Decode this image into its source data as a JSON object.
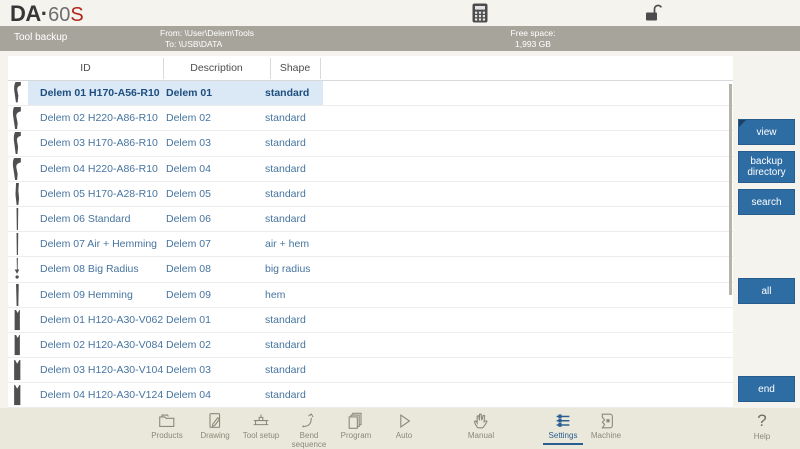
{
  "logo": {
    "brand": "DA",
    "separator": "·",
    "model": "60",
    "series": "S"
  },
  "top_icons": {
    "calculator": "calculator-icon",
    "lock": "unlock-icon"
  },
  "status_bar": {
    "title": "Tool backup",
    "from": "From: \\User\\Delem\\Tools",
    "to": "To: \\USB\\DATA",
    "free_space_label": "Free space:",
    "free_space_value": "1,993 GB"
  },
  "table": {
    "columns": [
      "ID",
      "Description",
      "Shape"
    ],
    "rows": [
      {
        "id": "Delem 01 H170-A56-R10",
        "description": "Delem 01",
        "shape": "standard",
        "icon": "punch-gooseneck-icon",
        "selected": true
      },
      {
        "id": "Delem 02 H220-A86-R10",
        "description": "Delem 02",
        "shape": "standard",
        "icon": "punch-gooseneck-large-icon",
        "selected": false
      },
      {
        "id": "Delem 03 H170-A86-R10",
        "description": "Delem 03",
        "shape": "standard",
        "icon": "punch-gooseneck-medium-icon",
        "selected": false
      },
      {
        "id": "Delem 04 H220-A86-R10",
        "description": "Delem 04",
        "shape": "standard",
        "icon": "punch-gooseneck-large-icon",
        "selected": false
      },
      {
        "id": "Delem 05 H170-A28-R10",
        "description": "Delem 05",
        "shape": "standard",
        "icon": "punch-slim-icon",
        "selected": false
      },
      {
        "id": "Delem 06 Standard",
        "description": "Delem 06",
        "shape": "standard",
        "icon": "punch-straight-icon",
        "selected": false
      },
      {
        "id": "Delem 07 Air + Hemming",
        "description": "Delem 07",
        "shape": "air + hem",
        "icon": "punch-straight-icon",
        "selected": false
      },
      {
        "id": "Delem 08 Big Radius",
        "description": "Delem 08",
        "shape": "big radius",
        "icon": "punch-radius-icon",
        "selected": false
      },
      {
        "id": "Delem 09 Hemming",
        "description": "Delem 09",
        "shape": "hem",
        "icon": "punch-hem-icon",
        "selected": false
      },
      {
        "id": "Delem 01 H120-A30-V062",
        "description": "Delem 01",
        "shape": "standard",
        "icon": "die-v-narrow-icon",
        "selected": false
      },
      {
        "id": "Delem 02 H120-A30-V084",
        "description": "Delem 02",
        "shape": "standard",
        "icon": "die-v-narrow-icon",
        "selected": false
      },
      {
        "id": "Delem 03 H120-A30-V104",
        "description": "Delem 03",
        "shape": "standard",
        "icon": "die-v-wide-icon",
        "selected": false
      },
      {
        "id": "Delem 04 H120-A30-V124",
        "description": "Delem 04",
        "shape": "standard",
        "icon": "die-v-wide-icon",
        "selected": false
      }
    ]
  },
  "side_buttons": [
    {
      "label": "view"
    },
    {
      "label": "backup directory"
    },
    {
      "label": "search"
    },
    {
      "label": "all"
    },
    {
      "label": "end"
    }
  ],
  "toolbar": {
    "items": [
      {
        "label": "Products",
        "icon": "products-icon",
        "active": false
      },
      {
        "label": "Drawing",
        "icon": "drawing-icon",
        "active": false
      },
      {
        "label": "Tool setup",
        "icon": "tool-setup-icon",
        "active": false
      },
      {
        "label": "Bend sequence",
        "icon": "bend-sequence-icon",
        "active": false
      },
      {
        "label": "Program",
        "icon": "program-icon",
        "active": false
      },
      {
        "label": "Auto",
        "icon": "auto-icon",
        "active": false
      },
      {
        "label": "Manual",
        "icon": "manual-icon",
        "active": false
      },
      {
        "label": "Settings",
        "icon": "settings-icon",
        "active": true
      },
      {
        "label": "Machine",
        "icon": "machine-icon",
        "active": false
      }
    ],
    "help": {
      "label": "Help",
      "icon": "help-icon"
    }
  },
  "colors": {
    "accent_blue": "#2e6da4",
    "active_blue": "#2b5d92",
    "selected_row_bg": "#dbe8f6",
    "row_text_blue": "#46749f",
    "status_bar_bg": "#a7a59b",
    "bottom_bar_bg": "#e9e8da",
    "logo_red": "#b3261c"
  }
}
